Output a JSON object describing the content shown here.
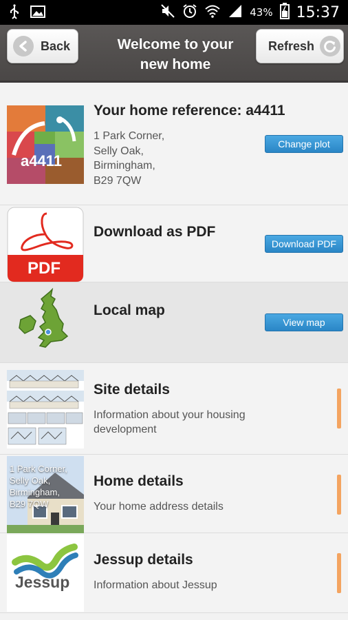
{
  "status_bar": {
    "battery_percent": "43%",
    "time": "15:37"
  },
  "header": {
    "back_label": "Back",
    "title_line1": "Welcome to your",
    "title_line2": "new home",
    "refresh_label": "Refresh"
  },
  "items": [
    {
      "title": "Your home reference: a4411",
      "thumb_text": "a4411",
      "address": [
        "1 Park Corner,",
        "Selly Oak,",
        "Birmingham,",
        "B29 7QW"
      ],
      "button": "Change plot"
    },
    {
      "title": "Download as PDF",
      "thumb_text": "PDF",
      "button": "Download PDF"
    },
    {
      "title": "Local map",
      "button": "View map"
    },
    {
      "title": "Site details",
      "subtitle_line1": "Information about your housing",
      "subtitle_line2": "development"
    },
    {
      "title": "Home details",
      "subtitle": "Your home address details",
      "thumb_text": [
        "1 Park Corner,",
        "Selly Oak,",
        "Birmingham,",
        "B29 7QW"
      ]
    },
    {
      "title": "Jessup details",
      "subtitle": "Information about Jessup",
      "thumb_text": "Jessup"
    }
  ],
  "colors": {
    "accent_blue": "#2a86c6",
    "indicator_orange": "#f4a460",
    "header_bg": "#4f4c4b"
  }
}
